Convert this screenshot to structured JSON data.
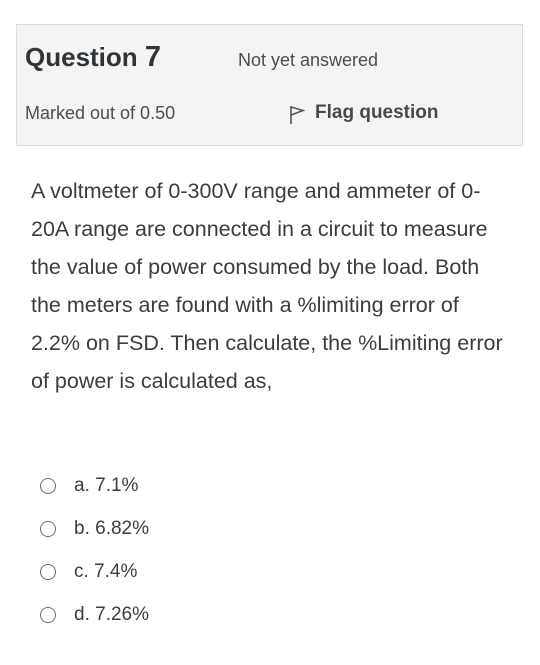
{
  "question": {
    "title_prefix": "Question",
    "number": "7",
    "state": "Not yet answered",
    "grade": "Marked out of 0.50",
    "flag_label": "Flag question",
    "text": "A voltmeter of 0-300V range and ammeter of 0-20A range are connected in a circuit to measure the value of power consumed by the load. Both the meters are found with a %limiting error of 2.2% on FSD. Then calculate, the %Limiting error of power is calculated as,",
    "options": [
      {
        "label": "a. 7.1%"
      },
      {
        "label": "b. 6.82%"
      },
      {
        "label": "c. 7.4%"
      },
      {
        "label": "d. 7.26%"
      }
    ]
  },
  "icons": {
    "flag": "flag-outline-icon",
    "radio": "radio-unchecked-icon"
  },
  "colors": {
    "info_bg": "#f4f4f4",
    "info_border": "#dcdcdc",
    "text": "#3a3d40"
  }
}
